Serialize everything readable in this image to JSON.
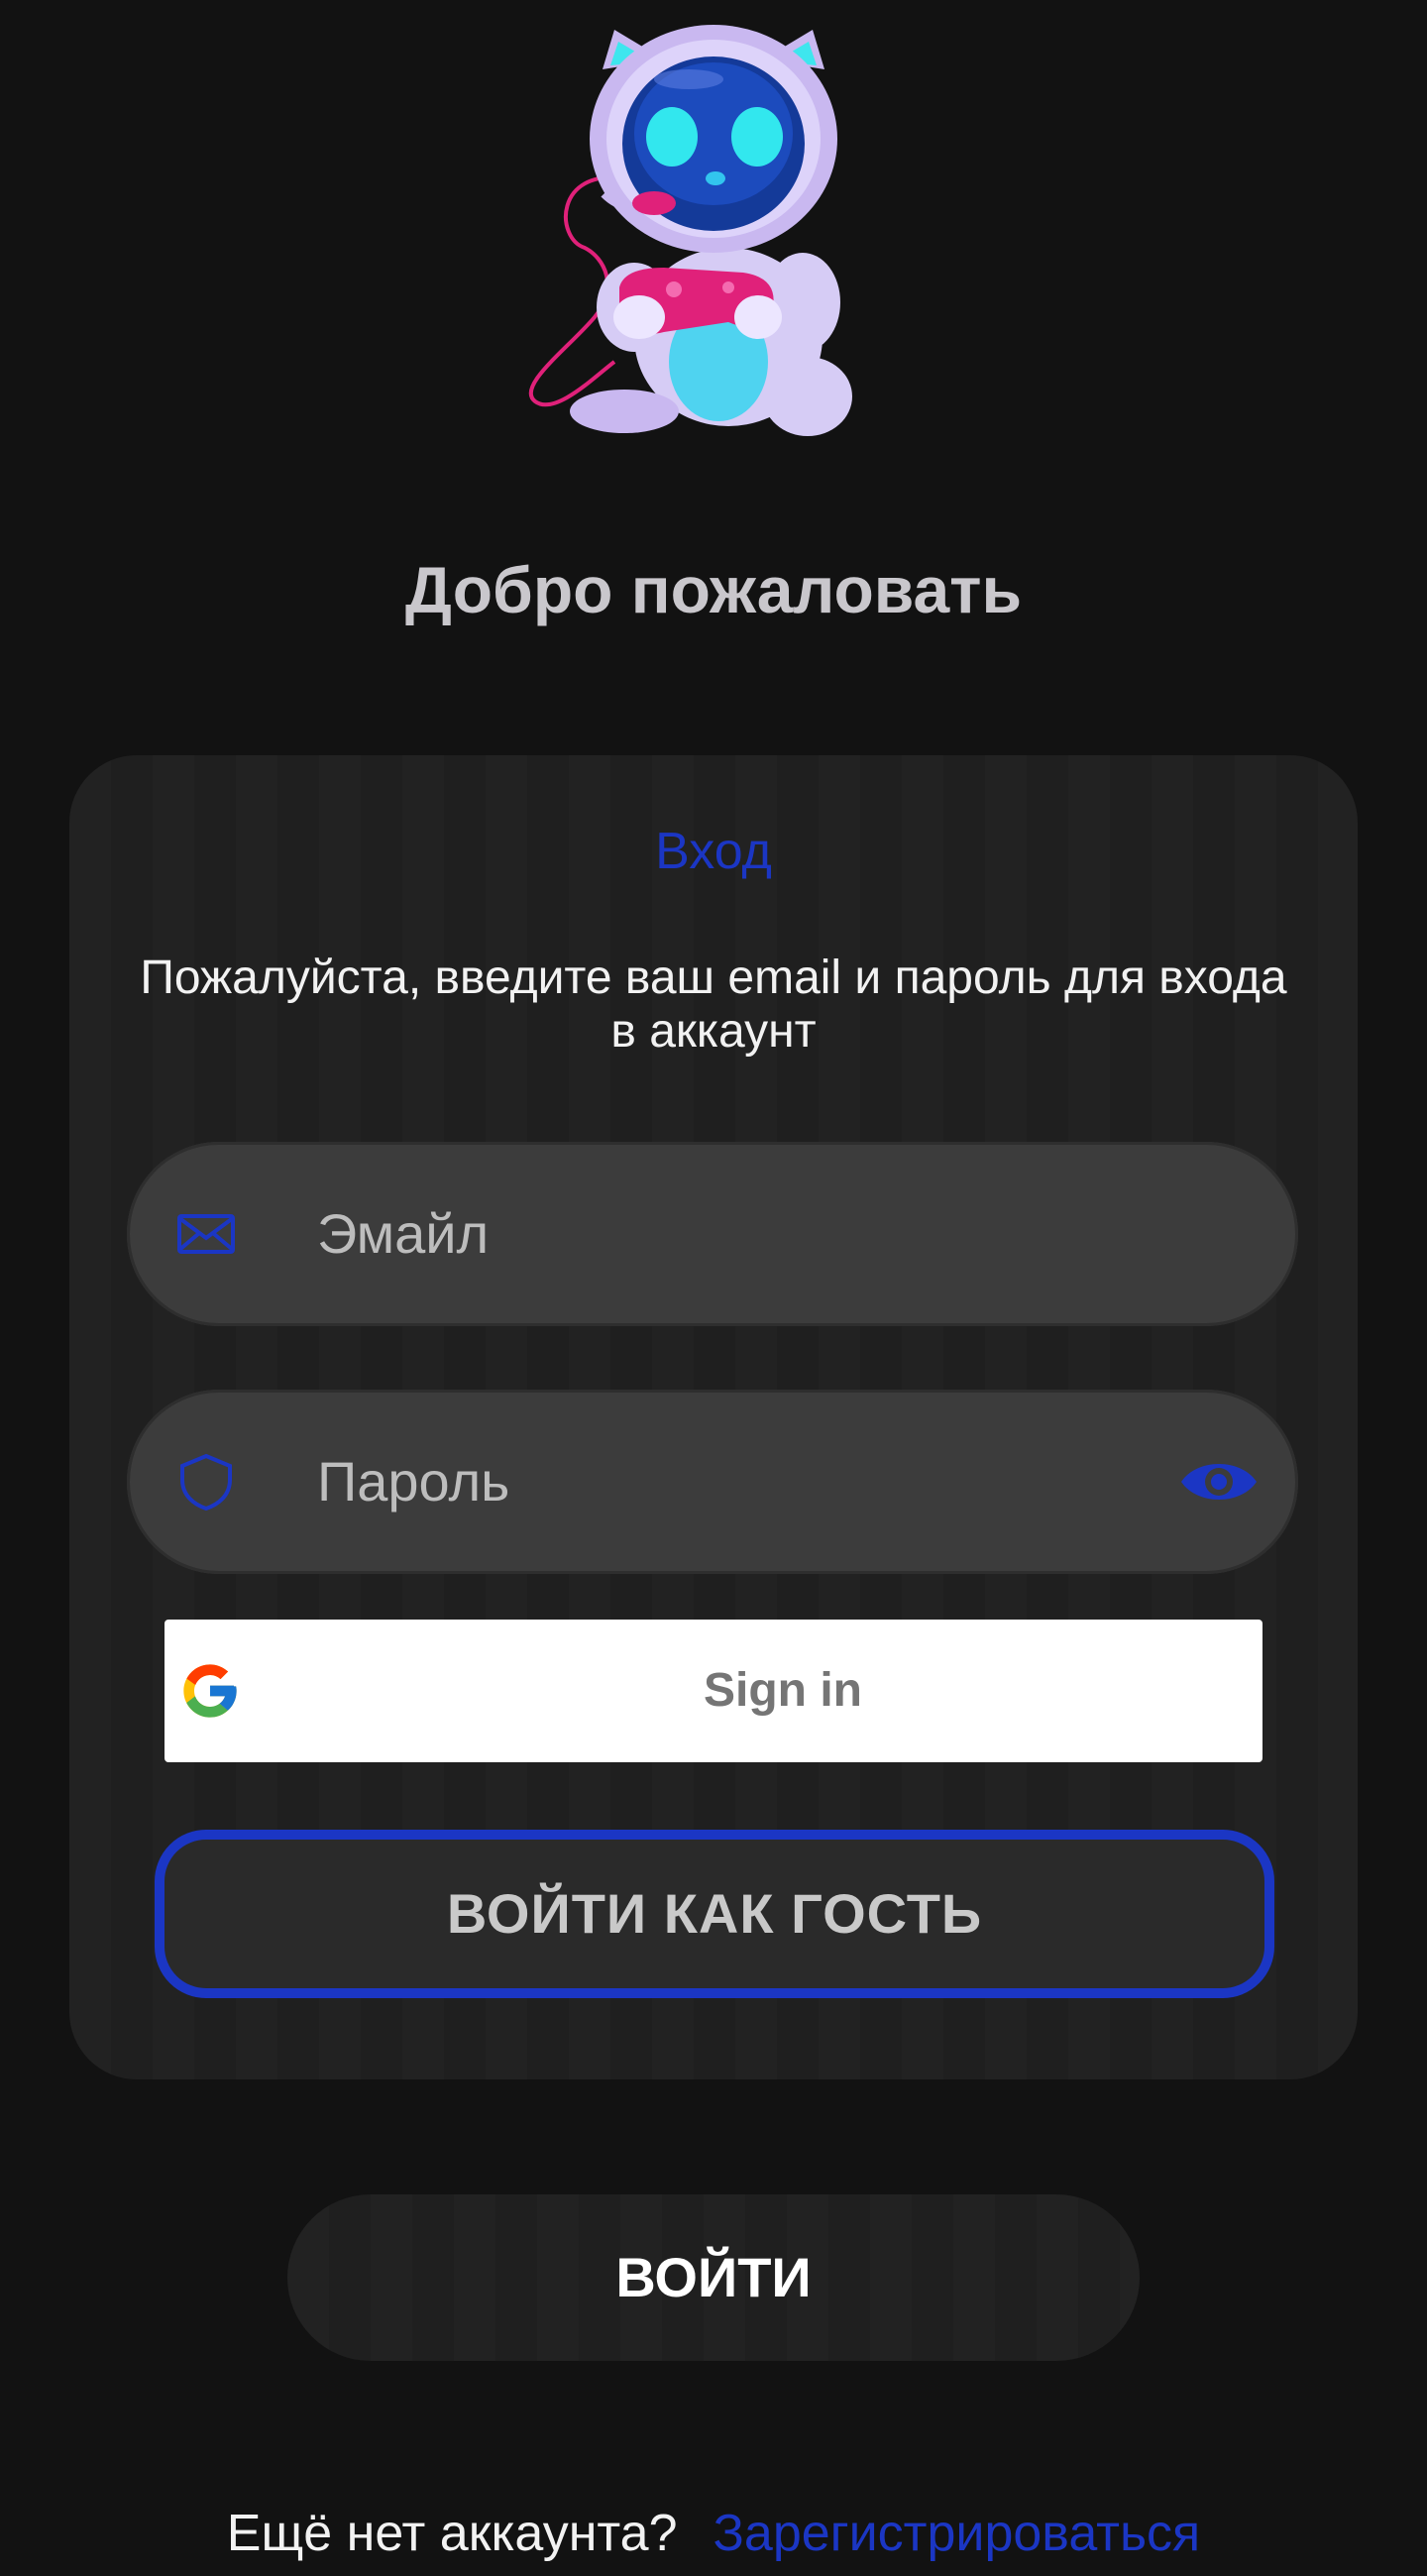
{
  "welcome_title": "Добро пожаловать",
  "login_card": {
    "title": "Вход",
    "subtitle": "Пожалуйста, введите ваш email и пароль для входа в аккаунт",
    "email_field": {
      "placeholder": "Эмайл",
      "value": "",
      "icon": "envelope-icon"
    },
    "password_field": {
      "placeholder": "Пароль",
      "value": "",
      "icon": "shield-icon",
      "toggle_icon": "eye-icon"
    },
    "google_button": {
      "label": "Sign in",
      "icon": "google-icon"
    },
    "guest_button": {
      "label": "ВОЙТИ КАК ГОСТЬ"
    }
  },
  "login_button": {
    "label": "ВОЙТИ"
  },
  "signup": {
    "question": "Ещё нет аккаунта?",
    "link": "Зарегистрироваться"
  },
  "colors": {
    "background": "#121212",
    "card": "#1f1f1f",
    "field": "#3c3c3c",
    "accent": "#1b36c4",
    "title_text": "#c9c7cc"
  }
}
